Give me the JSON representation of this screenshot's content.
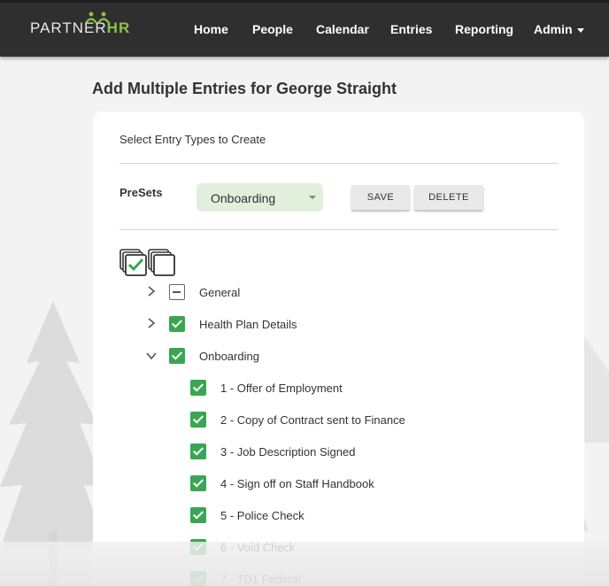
{
  "brand": {
    "logo_main": "PARTNER",
    "logo_accent": "HR",
    "accent_color": "#8bc34a"
  },
  "nav": {
    "items": [
      {
        "label": "Home"
      },
      {
        "label": "People"
      },
      {
        "label": "Calendar"
      },
      {
        "label": "Entries"
      },
      {
        "label": "Reporting"
      },
      {
        "label": "Admin"
      }
    ]
  },
  "page": {
    "title": "Add Multiple Entries for George Straight"
  },
  "form": {
    "subtitle": "Select Entry Types to Create",
    "presets_label": "PreSets",
    "preset_value": "Onboarding",
    "save_label": "SAVE",
    "delete_label": "DELETE"
  },
  "tree": {
    "groups": [
      {
        "label": "General",
        "state": "partial",
        "expanded": false
      },
      {
        "label": "Health Plan Details",
        "state": "checked",
        "expanded": false
      },
      {
        "label": "Onboarding",
        "state": "checked",
        "expanded": true
      }
    ],
    "onboarding_items": [
      {
        "label": "1 - Offer of Employment",
        "checked": true
      },
      {
        "label": "2 - Copy of Contract sent to Finance",
        "checked": true
      },
      {
        "label": "3 - Job Description Signed",
        "checked": true
      },
      {
        "label": "4 - Sign off on Staff Handbook",
        "checked": true
      },
      {
        "label": "5 - Police Check",
        "checked": true
      },
      {
        "label": "6 - Void Check",
        "checked": true
      },
      {
        "label": "7 - TD1 Federal",
        "checked": true
      }
    ]
  },
  "colors": {
    "topbar": "#2f2f2f",
    "checkbox_green": "#3aa654",
    "select_bg": "#e2efdc"
  }
}
